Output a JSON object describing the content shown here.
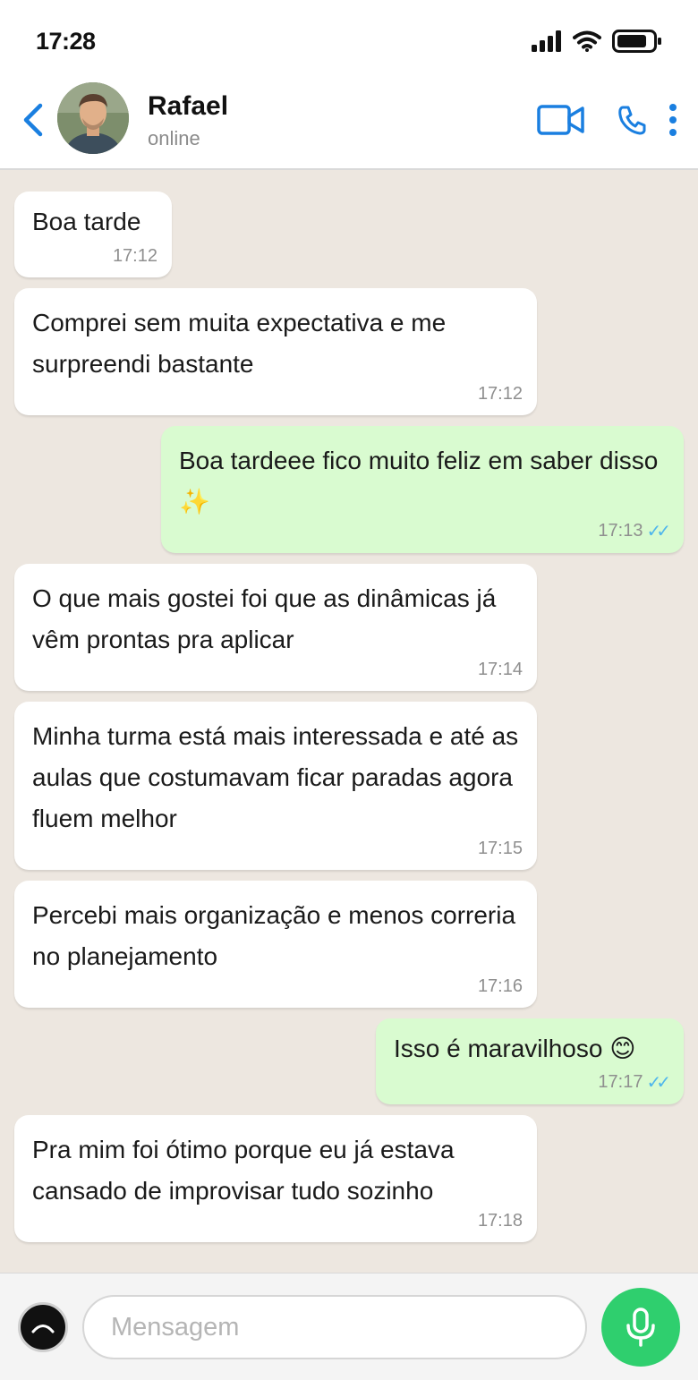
{
  "status_bar": {
    "time": "17:28"
  },
  "header": {
    "contact_name": "Rafael",
    "contact_status": "online",
    "icons": {
      "back": "chevron-left-icon",
      "video": "video-camera-icon",
      "call": "phone-icon",
      "menu": "kebab-menu-icon"
    }
  },
  "messages": [
    {
      "direction": "in",
      "text": "Boa tarde",
      "time": "17:12"
    },
    {
      "direction": "in",
      "text": "Comprei sem muita expectativa e me surpreendi bastante",
      "time": "17:12"
    },
    {
      "direction": "out",
      "text": "Boa tardeee fico muito feliz em saber disso ✨",
      "time": "17:13",
      "ticks": "✓✓"
    },
    {
      "direction": "in",
      "text": "O que mais gostei foi que as dinâmicas já vêm prontas pra aplicar",
      "time": "17:14"
    },
    {
      "direction": "in",
      "text": "Minha turma está mais interessada e até as aulas que costumavam ficar paradas agora fluem melhor",
      "time": "17:15"
    },
    {
      "direction": "in",
      "text": "Percebi mais organização e menos correria no planejamento",
      "time": "17:16"
    },
    {
      "direction": "out",
      "text": "Isso é maravilhoso 😊",
      "time": "17:17",
      "ticks": "✓✓"
    },
    {
      "direction": "in",
      "text": "Pra mim foi ótimo porque eu já estava cansado de improvisar tudo sozinho",
      "time": "17:18"
    }
  ],
  "composer": {
    "placeholder": "Mensagem",
    "icons": {
      "sticker": "sticker-icon",
      "mic": "microphone-icon"
    }
  },
  "colors": {
    "accent": "#1a7fe0",
    "chat_background": "#ede7e0",
    "incoming_bubble": "#ffffff",
    "outgoing_bubble": "#d9fbd0",
    "read_ticks": "#4fb6ec",
    "mic_button": "#2fcf6e"
  }
}
